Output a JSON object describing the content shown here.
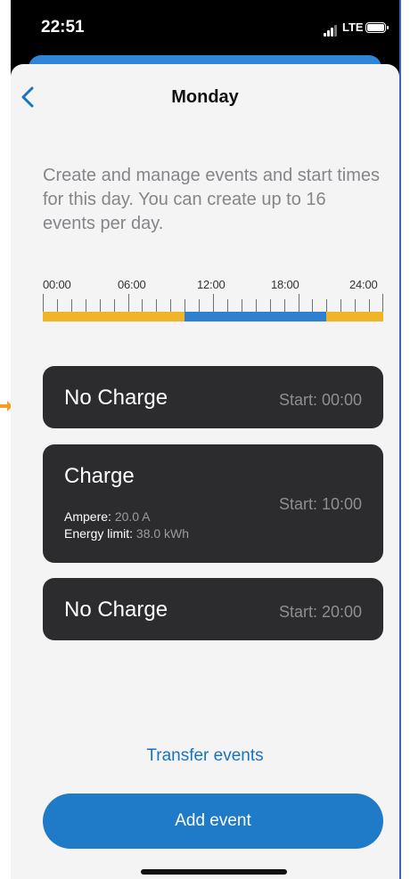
{
  "status_bar": {
    "time": "22:51",
    "network": "LTE"
  },
  "header": {
    "title": "Monday",
    "back_icon": "chevron-left-icon"
  },
  "description": "Create and manage events and start times for this day. You can create up to 16 events per day.",
  "timeline": {
    "labels": [
      "00:00",
      "06:00",
      "12:00",
      "18:00",
      "24:00"
    ],
    "segments": [
      {
        "from": "00:00",
        "to": "10:00",
        "type": "No Charge",
        "color": "#f0b429"
      },
      {
        "from": "10:00",
        "to": "20:00",
        "type": "Charge",
        "color": "#2f80cf"
      },
      {
        "from": "20:00",
        "to": "24:00",
        "type": "No Charge",
        "color": "#f0b429"
      }
    ]
  },
  "events": [
    {
      "type": "No Charge",
      "start": "Start:  00:00"
    },
    {
      "type": "Charge",
      "start": "Start:  10:00",
      "ampere_label": "Ampere:",
      "ampere_value": "20.0 A",
      "energy_label": "Energy limit:",
      "energy_value": "38.0 kWh"
    },
    {
      "type": "No Charge",
      "start": "Start:  20:00"
    }
  ],
  "actions": {
    "transfer_label": "Transfer events",
    "add_label": "Add event"
  },
  "colors": {
    "accent": "#1f7ac7",
    "link": "#1a73c0",
    "card": "#2c2c2f",
    "no_charge": "#f0b429",
    "charge": "#2f80cf"
  }
}
